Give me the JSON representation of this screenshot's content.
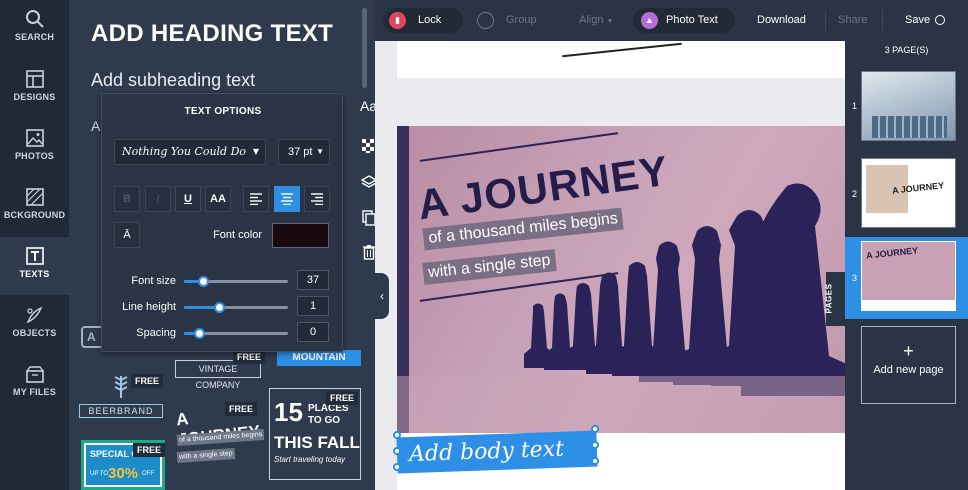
{
  "rail": {
    "items": [
      {
        "label": "SEARCH",
        "icon": "search-icon"
      },
      {
        "label": "DESIGNS",
        "icon": "designs-icon"
      },
      {
        "label": "PHOTOS",
        "icon": "photos-icon"
      },
      {
        "label": "BCKGROUND",
        "icon": "background-icon"
      },
      {
        "label": "TEXTS",
        "icon": "texts-icon"
      },
      {
        "label": "OBJECTS",
        "icon": "objects-icon"
      },
      {
        "label": "MY FILES",
        "icon": "my-files-icon"
      }
    ]
  },
  "panel": {
    "heading": "ADD HEADING TEXT",
    "subheading": "Add subheading text",
    "body": "Add bo",
    "free_badge": "FREE",
    "templates": {
      "vintage": "VINTAGE COMPANY",
      "mountain": "MOUNTAIN",
      "beerbrand": "BEERBRAND",
      "journey": [
        "A JOURNEY",
        "of a thousand miles begins",
        "with a single step"
      ],
      "places": [
        "15",
        "PLACES",
        "TO GO",
        "THIS FALL",
        "Start traveling today"
      ],
      "special": [
        "SPECIAL OFFER",
        "UP TO",
        "30%",
        "OFF"
      ]
    }
  },
  "text_options": {
    "title": "TEXT OPTIONS",
    "font": "Nothing You Could Do",
    "size": "37 pt",
    "format_buttons": [
      "B",
      "I",
      "U",
      "AA"
    ],
    "font_color_label": "Font color",
    "font_color": "#1a0a0f",
    "sliders": [
      {
        "label": "Font size",
        "value": "37",
        "level": 0.18
      },
      {
        "label": "Line height",
        "value": "1",
        "level": 0.34
      },
      {
        "label": "Spacing",
        "value": "0",
        "level": 0.14
      }
    ]
  },
  "toolbar": {
    "lock": "Lock",
    "group": "Group",
    "align": "Align",
    "photo_text": "Photo Text",
    "download": "Download",
    "share": "Share",
    "save": "Save"
  },
  "canvas": {
    "title": "A JOURNEY",
    "line1": "of a thousand miles begins",
    "line2": "with a single step",
    "body_text": "Add body text"
  },
  "pages": {
    "count_label": "3 PAGE(S)",
    "numbers": [
      "1",
      "2",
      "3"
    ],
    "add_label": "Add new page",
    "tab": "PAGES"
  },
  "colors": {
    "accent": "#2f8fe3",
    "lock": "#e0455b",
    "photo_text": "#b56bd8"
  }
}
